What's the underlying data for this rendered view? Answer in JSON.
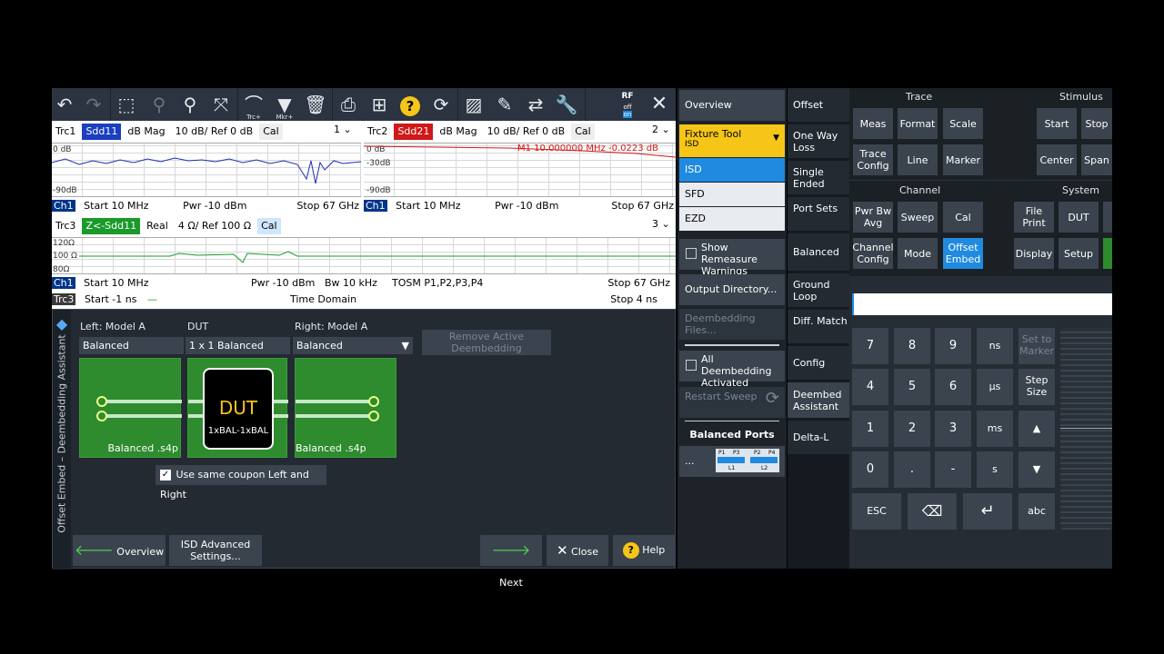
{
  "toolbar": {
    "trc_label": "Trc+",
    "mkr_label": "Mkr+",
    "rf_label": "RF",
    "rf_off": "off",
    "rf_on": "on"
  },
  "trace1": {
    "trc": "Trc1",
    "param": "Sdd11",
    "format": "dB Mag",
    "scale": "10 dB/ Ref 0 dB",
    "cal": "Cal",
    "num": "1",
    "ref_label": "0 dB",
    "bottom_label": "-90dB",
    "ch": "Ch1",
    "start": "Start  10 MHz",
    "pwr": "Pwr  -10 dBm",
    "stop": "Stop  67 GHz"
  },
  "trace2": {
    "trc": "Trc2",
    "param": "Sdd21",
    "format": "dB Mag",
    "scale": "10 dB/ Ref 0 dB",
    "cal": "Cal",
    "num": "2",
    "ref_label": "0 dB",
    "mid_label": "-30dB",
    "bottom_label": "-90dB",
    "marker": "M1  10.000000  MHz  -0.0223  dB",
    "ch": "Ch1",
    "start": "Start  10 MHz",
    "pwr": "Pwr  -10 dBm",
    "stop": "Stop  67 GHz"
  },
  "trace3": {
    "trc": "Trc3",
    "param": "Z<-Sdd11",
    "format": "Real",
    "scale": "4 Ω/ Ref 100 Ω",
    "cal": "Cal",
    "num": "3",
    "top_label": "120Ω",
    "ref_label": "100 Ω",
    "bottom_label": "80Ω",
    "ch": "Ch1",
    "start": "Start  10 MHz",
    "pwr": "Pwr  -10 dBm",
    "bw": "Bw  10 kHz",
    "tosm": "TOSM P1,P2,P3,P4",
    "stop": "Stop  67 GHz",
    "trc_time": "Trc3",
    "start_time": "Start  -1 ns",
    "time_domain": "Time  Domain",
    "stop_time": "Stop  4 ns"
  },
  "wizard": {
    "side_title": "Offset Embed – Deembedding Assistant",
    "left_label": "Left: Model A",
    "dut_label": "DUT",
    "right_label": "Right: Model A",
    "left_value": "Balanced",
    "dut_value": "1 x 1 Balanced",
    "right_value": "Balanced",
    "remove_btn": "Remove Active Deembedding",
    "left_file": "Balanced .s4p",
    "right_file": "Balanced .s4p",
    "dut_title": "DUT",
    "dut_sub": "1xBAL-1xBAL",
    "coupon_checkbox": "Use same coupon Left and Right",
    "overview_btn": "Overview",
    "isd_btn": "ISD Advanced Settings...",
    "next_btn": "Next",
    "close_btn": "Close",
    "help_btn": "Help"
  },
  "midmenu": {
    "overview": "Overview",
    "fixture_tool": "Fixture Tool",
    "fixture_value": "ISD",
    "options": [
      "ISD",
      "SFD",
      "EZD"
    ],
    "show_remeasure": "Show Remeasure Warnings",
    "output_dir": "Output Directory...",
    "deembed_files": "Deembedding Files...",
    "all_deembed": "All Deembedding Activated",
    "restart_sweep": "Restart Sweep",
    "balanced_ports": "Balanced Ports",
    "ports_more": "...",
    "port_labels": [
      "P1",
      "P3",
      "P2",
      "P4",
      "L1",
      "L2"
    ]
  },
  "softkeys": [
    "Offset",
    "One Way Loss",
    "Single Ended",
    "Port Sets",
    "Balanced",
    "Ground Loop",
    "Diff. Match",
    "Config",
    "Deembed Assistant",
    "Delta-L"
  ],
  "hardkeys": {
    "trace_group": "Trace",
    "stimulus_group": "Stimulus",
    "channel_group": "Channel",
    "system_group": "System",
    "meas": "Meas",
    "format": "Format",
    "scale": "Scale",
    "start": "Start",
    "stop": "Stop",
    "trace_config": "Trace Config",
    "line": "Line",
    "marker": "Marker",
    "center": "Center",
    "span": "Span",
    "pwr_bw_avg": "Pwr Bw Avg",
    "sweep": "Sweep",
    "cal": "Cal",
    "file_print": "File Print",
    "dut": "DUT",
    "channel_config": "Channel Config",
    "mode": "Mode",
    "offset_embed": "Offset Embed",
    "display": "Display",
    "setup": "Setup"
  },
  "numpad": {
    "input_value": "",
    "k7": "7",
    "k8": "8",
    "k9": "9",
    "ns": "ns",
    "set_marker": "Set to Marker",
    "k4": "4",
    "k5": "5",
    "k6": "6",
    "us": "µs",
    "step_size": "Step Size",
    "k1": "1",
    "k2": "2",
    "k3": "3",
    "ms": "ms",
    "up": "▲",
    "k0": "0",
    "dot": ".",
    "minus": "-",
    "s": "s",
    "down": "▼",
    "esc": "ESC",
    "backspace": "⌫",
    "enter": "↵",
    "abc": "abc"
  },
  "colors": {
    "accent_yellow": "#f5c518",
    "active_blue": "#1f8ae0",
    "coupon_green": "#2e8b2e"
  }
}
